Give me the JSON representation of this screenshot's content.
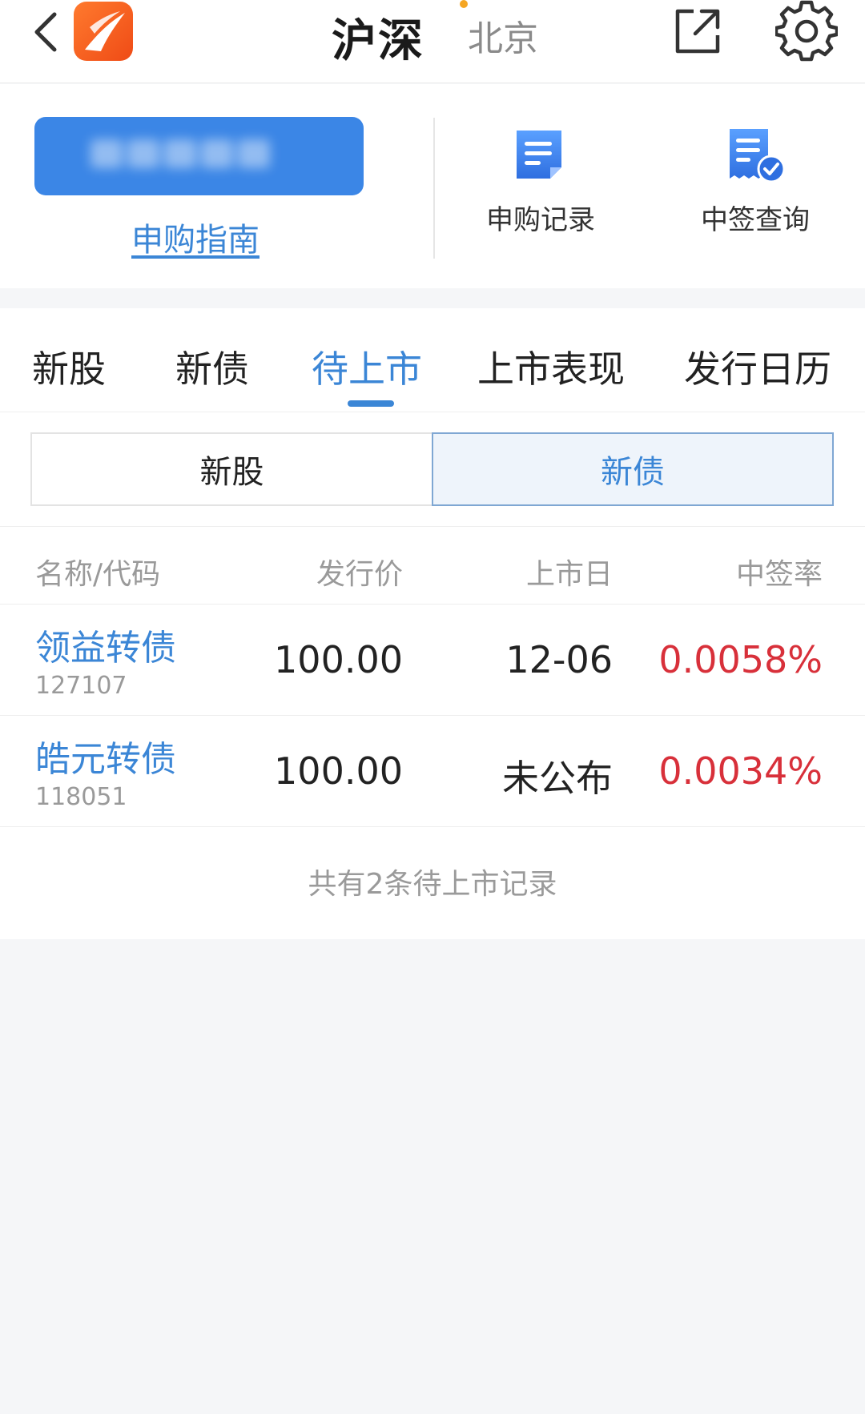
{
  "header": {
    "title": "沪深",
    "subtitle": "北京",
    "back_icon": "back-chevron-icon",
    "logo": "app-logo",
    "share_icon": "share-external-icon",
    "settings_icon": "gear-icon",
    "accent": "#3b86d6"
  },
  "actions": {
    "guide_label": "申购指南",
    "items": [
      {
        "label": "申购记录",
        "icon": "document-record-icon"
      },
      {
        "label": "中签查询",
        "icon": "document-check-icon"
      }
    ]
  },
  "tabs": [
    {
      "label": "新股",
      "active": false
    },
    {
      "label": "新债",
      "active": false
    },
    {
      "label": "待上市",
      "active": true
    },
    {
      "label": "上市表现",
      "active": false
    },
    {
      "label": "发行日历",
      "active": false
    }
  ],
  "segment": {
    "options": [
      "新股",
      "新债"
    ],
    "selected": "新债"
  },
  "table": {
    "headers": [
      "名称/代码",
      "发行价",
      "上市日",
      "中签率"
    ],
    "rows": [
      {
        "name": "领益转债",
        "code": "127107",
        "price": "100.00",
        "date": "12-06",
        "rate": "0.0058%"
      },
      {
        "name": "皓元转债",
        "code": "118051",
        "price": "100.00",
        "date": "未公布",
        "rate": "0.0034%"
      }
    ]
  },
  "footer": {
    "note": "共有2条待上市记录"
  },
  "colors": {
    "link_blue": "#3b86d6",
    "rate_red": "#d8303a",
    "button_blue": "#3b86e6",
    "logo_orange": "#ef4b16"
  }
}
